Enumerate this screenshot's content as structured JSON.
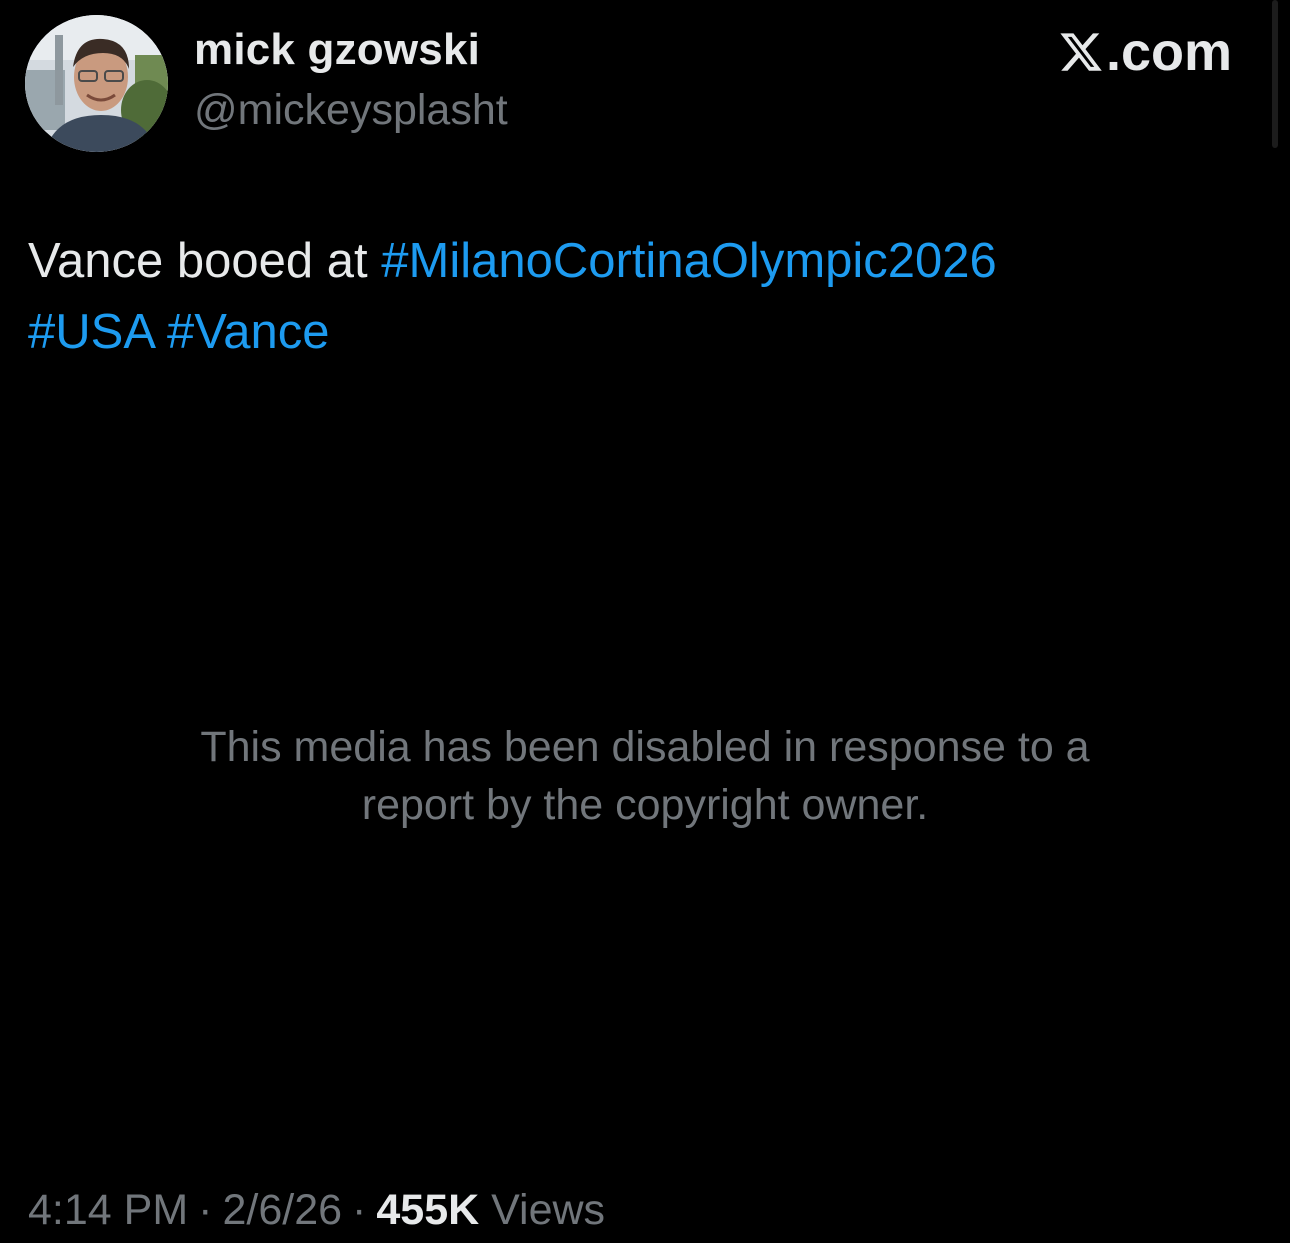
{
  "author": {
    "display_name": "mick gzowski",
    "handle": "@mickeysplasht",
    "avatar_icon": "user-photo-avatar"
  },
  "branding": {
    "logo_icon": "x-logo-icon",
    "domain_suffix": ".com"
  },
  "tweet": {
    "text_lead": "Vance booed at ",
    "hashtags": [
      "#MilanoCortinaOlympic2026",
      "#USA",
      "#Vance"
    ]
  },
  "media": {
    "notice_line1": "This media has been disabled in response to a",
    "notice_line2": "report by the copyright owner."
  },
  "meta": {
    "time": "4:14 PM",
    "separator": "·",
    "date": "2/6/26",
    "views_count": "455K",
    "views_label": "Views"
  },
  "colors": {
    "background": "#000000",
    "primary_text": "#e7e9ea",
    "secondary_text": "#71767b",
    "link": "#1d9bf0"
  }
}
